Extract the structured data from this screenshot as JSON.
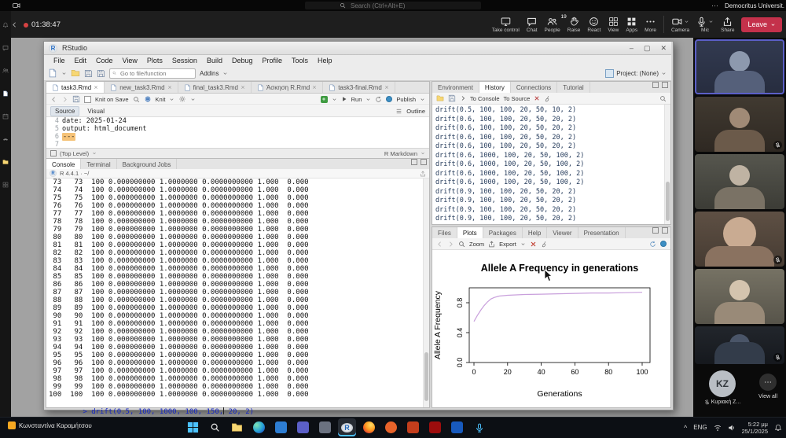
{
  "glyphs": {
    "r_logo": "R",
    "minimize": "–",
    "maximize": "▢",
    "close": "✕",
    "ellipsis": "⋯",
    "tray_chevron": "^"
  },
  "top_bar": {
    "search_placeholder": "Search (Ctrl+Alt+E)",
    "org_name": "Democritus Universit...",
    "more_label": "⋯"
  },
  "meeting": {
    "timer": "01:38:47",
    "buttons": [
      {
        "label": "Take control"
      },
      {
        "label": "Chat"
      },
      {
        "label": "People",
        "badge": "19"
      },
      {
        "label": "Raise"
      },
      {
        "label": "React"
      },
      {
        "label": "View"
      },
      {
        "label": "Apps"
      },
      {
        "label": "More"
      },
      {
        "label": "Camera"
      },
      {
        "label": "Mic"
      },
      {
        "label": "Share"
      },
      {
        "label": "Leave"
      }
    ]
  },
  "rail": {
    "icons": [
      "activity",
      "chat",
      "teams",
      "assignments",
      "calendar",
      "calls",
      "files",
      "apps"
    ]
  },
  "rstudio": {
    "title": "RStudio",
    "menus": [
      "File",
      "Edit",
      "Code",
      "View",
      "Plots",
      "Session",
      "Build",
      "Debug",
      "Profile",
      "Tools",
      "Help"
    ],
    "toolbar": {
      "goto_placeholder": "Go to file/function",
      "addins_label": "Addins",
      "project_label": "Project: (None)"
    },
    "editor": {
      "tabs": [
        "task3.Rmd",
        "new_task3.Rmd",
        "final_task3.Rmd",
        "Άσκηση R.Rmd",
        "task3-final.Rmd"
      ],
      "active_tab": "task3.Rmd",
      "knit_on_save": "Knit on Save",
      "knit_label": "Knit",
      "run_label": "Run",
      "publish_label": "Publish",
      "source_label": "Source",
      "visual_label": "Visual",
      "outline_label": "Outline",
      "lines": [
        {
          "num": "4",
          "text": "date: 2025-01-24"
        },
        {
          "num": "5",
          "text": "output: html_document"
        },
        {
          "num": "6",
          "text": "---"
        },
        {
          "num": "7",
          "text": ""
        }
      ],
      "status_left": "(Top Level)",
      "status_right": "R Markdown"
    },
    "console": {
      "tabs": [
        "Console",
        "Terminal",
        "Background Jobs"
      ],
      "active_tab": "Console",
      "header": "R 4.4.1 · ~/",
      "rows": [
        " 73   73  100 0.000000000 1.0000000 0.0000000000 1.000  0.000",
        " 74   74  100 0.000000000 1.0000000 0.0000000000 1.000  0.000",
        " 75   75  100 0.000000000 1.0000000 0.0000000000 1.000  0.000",
        " 76   76  100 0.000000000 1.0000000 0.0000000000 1.000  0.000",
        " 77   77  100 0.000000000 1.0000000 0.0000000000 1.000  0.000",
        " 78   78  100 0.000000000 1.0000000 0.0000000000 1.000  0.000",
        " 79   79  100 0.000000000 1.0000000 0.0000000000 1.000  0.000",
        " 80   80  100 0.000000000 1.0000000 0.0000000000 1.000  0.000",
        " 81   81  100 0.000000000 1.0000000 0.0000000000 1.000  0.000",
        " 82   82  100 0.000000000 1.0000000 0.0000000000 1.000  0.000",
        " 83   83  100 0.000000000 1.0000000 0.0000000000 1.000  0.000",
        " 84   84  100 0.000000000 1.0000000 0.0000000000 1.000  0.000",
        " 85   85  100 0.000000000 1.0000000 0.0000000000 1.000  0.000",
        " 86   86  100 0.000000000 1.0000000 0.0000000000 1.000  0.000",
        " 87   87  100 0.000000000 1.0000000 0.0000000000 1.000  0.000",
        " 88   88  100 0.000000000 1.0000000 0.0000000000 1.000  0.000",
        " 89   89  100 0.000000000 1.0000000 0.0000000000 1.000  0.000",
        " 90   90  100 0.000000000 1.0000000 0.0000000000 1.000  0.000",
        " 91   91  100 0.000000000 1.0000000 0.0000000000 1.000  0.000",
        " 92   92  100 0.000000000 1.0000000 0.0000000000 1.000  0.000",
        " 93   93  100 0.000000000 1.0000000 0.0000000000 1.000  0.000",
        " 94   94  100 0.000000000 1.0000000 0.0000000000 1.000  0.000",
        " 95   95  100 0.000000000 1.0000000 0.0000000000 1.000  0.000",
        " 96   96  100 0.000000000 1.0000000 0.0000000000 1.000  0.000",
        " 97   97  100 0.000000000 1.0000000 0.0000000000 1.000  0.000",
        " 98   98  100 0.000000000 1.0000000 0.0000000000 1.000  0.000",
        " 99   99  100 0.000000000 1.0000000 0.0000000000 1.000  0.000",
        "100  100  100 0.000000000 1.0000000 0.0000000000 1.000  0.000"
      ],
      "prompt_before_cursor": "> drift(0.5, 100, 1000, 100, 150,",
      "prompt_after_cursor": " 20, 2)"
    },
    "environment": {
      "tabs": [
        "Environment",
        "History",
        "Connections",
        "Tutorial"
      ],
      "active_tab": "History",
      "to_console_label": "To Console",
      "to_source_label": "To Source",
      "history": [
        "drift(0.5, 100, 100, 20, 50, 10, 2)",
        "drift(0.6, 100, 100, 20, 50, 20, 2)",
        "drift(0.6, 100, 100, 20, 50, 20, 2)",
        "drift(0.6, 100, 100, 20, 50, 20, 2)",
        "drift(0.6, 100, 100, 20, 50, 20, 2)",
        "drift(0.6, 1000, 100, 20, 50, 100, 2)",
        "drift(0.6, 1000, 100, 20, 50, 100, 2)",
        "drift(0.6, 1000, 100, 20, 50, 100, 2)",
        "drift(0.6, 1000, 100, 20, 50, 100, 2)",
        "drift(0.9, 100, 100, 20, 50, 20, 2)",
        "drift(0.9, 100, 100, 20, 50, 20, 2)",
        "drift(0.9, 100, 100, 20, 50, 20, 2)",
        "drift(0.9, 100, 100, 20, 50, 20, 2)"
      ]
    },
    "files_pane": {
      "tabs": [
        "Files",
        "Plots",
        "Packages",
        "Help",
        "Viewer",
        "Presentation"
      ],
      "active_tab": "Plots",
      "zoom_label": "Zoom",
      "export_label": "Export"
    }
  },
  "chart_data": {
    "type": "line",
    "title": "Allele A Frequency in generations",
    "xlabel": "Generations",
    "ylabel": "Allele A Frequency",
    "xlim": [
      0,
      100
    ],
    "ylim": [
      0.0,
      1.0
    ],
    "xticks": [
      0,
      20,
      40,
      60,
      80,
      100
    ],
    "yticks": [
      0.0,
      0.4,
      0.8
    ],
    "grid": false,
    "legend": "none",
    "line_color": "#c9a0dc",
    "series": [
      {
        "name": "Allele A frequency",
        "x": [
          0,
          2,
          4,
          6,
          8,
          10,
          12,
          15,
          20,
          25,
          30,
          40,
          50,
          60,
          70,
          80,
          90,
          100
        ],
        "y": [
          0.55,
          0.63,
          0.7,
          0.76,
          0.81,
          0.85,
          0.87,
          0.89,
          0.9,
          0.905,
          0.91,
          0.915,
          0.92,
          0.925,
          0.93,
          0.93,
          0.935,
          0.94
        ]
      }
    ]
  },
  "participants": {
    "video_count": 6,
    "bottom": {
      "initials": "KZ",
      "name": "Κυριακή Ζ...",
      "view_all_label": "View all"
    }
  },
  "taskbar": {
    "presenter_name": "Κωνσταντίνα Καραμήτσου",
    "language": "ENG",
    "time": "5:22 μμ",
    "date": "25/1/2025",
    "icons": [
      "windows-start",
      "search",
      "file-explorer",
      "edge",
      "app-blue",
      "teams",
      "app-gray",
      "rstudio",
      "firefox",
      "app-orange",
      "powerpoint",
      "acrobat",
      "word",
      "teams-mic"
    ]
  }
}
